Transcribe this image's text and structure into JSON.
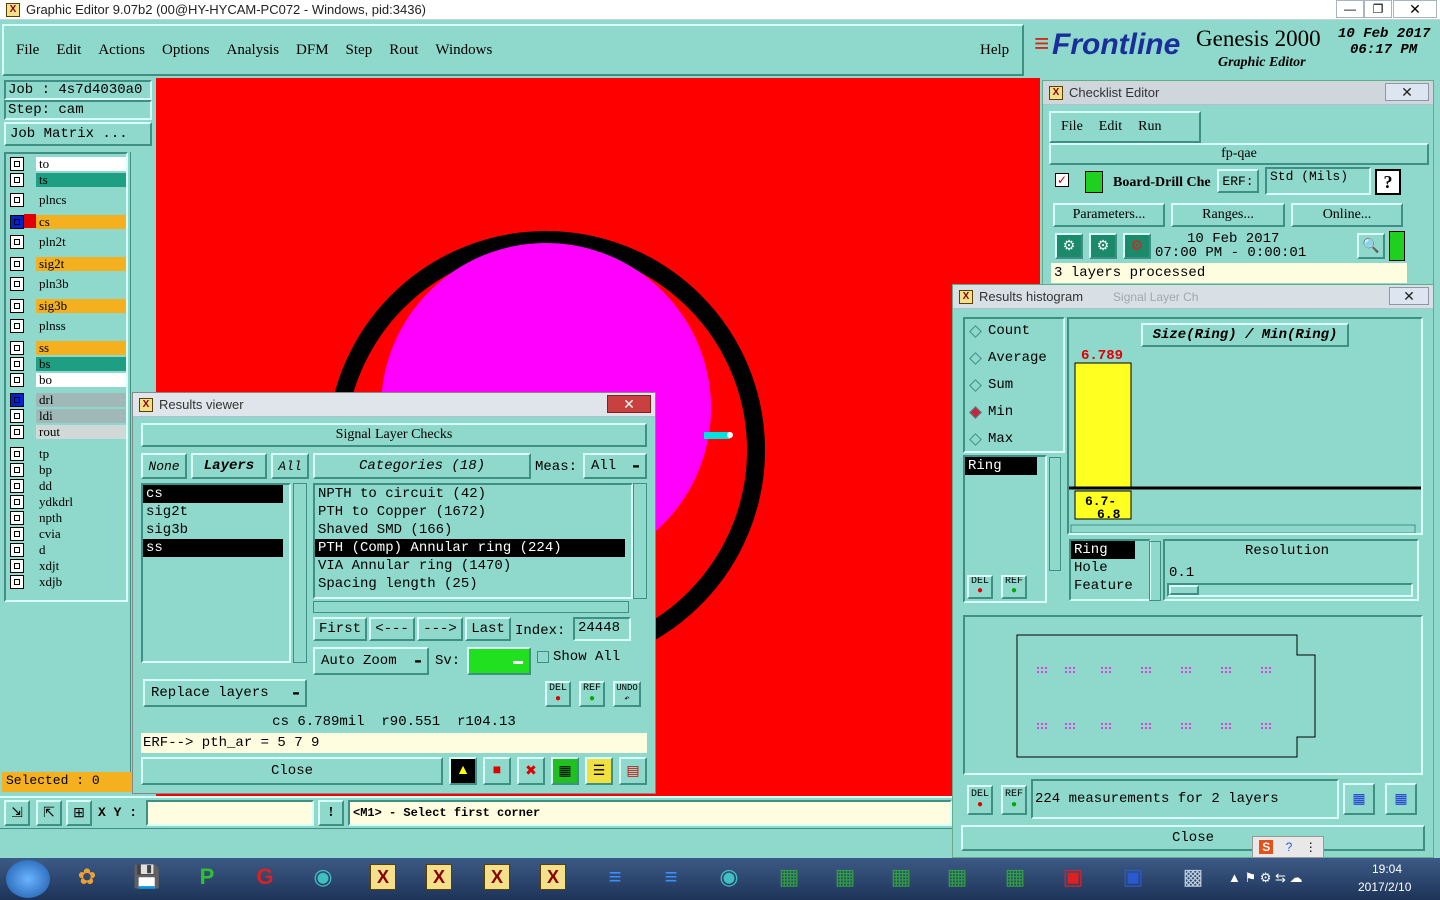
{
  "window": {
    "title": "Graphic Editor 9.07b2 (00@HY-HYCAM-PC072 - Windows, pid:3436)"
  },
  "menu": {
    "items": [
      "File",
      "Edit",
      "Actions",
      "Options",
      "Analysis",
      "DFM",
      "Step",
      "Rout",
      "Windows"
    ],
    "help": "Help"
  },
  "brand": {
    "logo": "Frontline",
    "product": "Genesis 2000",
    "subtitle": "Graphic Editor",
    "date": "10 Feb 2017",
    "time": "06:17 PM"
  },
  "job": {
    "job_label": "Job : 4s7d4030a0",
    "step_label": "Step: cam",
    "matrix_button": "Job Matrix ..."
  },
  "layers": [
    {
      "name": "to",
      "bg": "#ffffff"
    },
    {
      "name": "ts",
      "bg": "#1e9e82"
    },
    {
      "name": "plncs",
      "bg": "#8fd8cc"
    },
    {
      "name": "cs",
      "bg": "#f5b020"
    },
    {
      "name": "pln2t",
      "bg": "#8fd8cc"
    },
    {
      "name": "sig2t",
      "bg": "#f5b020"
    },
    {
      "name": "pln3b",
      "bg": "#8fd8cc"
    },
    {
      "name": "sig3b",
      "bg": "#f5b020"
    },
    {
      "name": "plnss",
      "bg": "#8fd8cc"
    },
    {
      "name": "ss",
      "bg": "#f5b020"
    },
    {
      "name": "bs",
      "bg": "#1e9e82"
    },
    {
      "name": "bo",
      "bg": "#ffffff"
    },
    {
      "name": "drl",
      "bg": "#a0b8b8"
    },
    {
      "name": "ldi",
      "bg": "#a0b8b8"
    },
    {
      "name": "rout",
      "bg": "#d0d8d8"
    },
    {
      "name": "tp",
      "bg": "#8fd8cc"
    },
    {
      "name": "bp",
      "bg": "#8fd8cc"
    },
    {
      "name": "dd",
      "bg": "#8fd8cc"
    },
    {
      "name": "ydkdrl",
      "bg": "#8fd8cc"
    },
    {
      "name": "npth",
      "bg": "#8fd8cc"
    },
    {
      "name": "cvia",
      "bg": "#8fd8cc"
    },
    {
      "name": "d",
      "bg": "#8fd8cc"
    },
    {
      "name": "xdjt",
      "bg": "#8fd8cc"
    },
    {
      "name": "xdjb",
      "bg": "#8fd8cc"
    }
  ],
  "status": {
    "selected": "Selected : 0",
    "xy_label": "X Y :",
    "prompt": "<M1> - Select first corner"
  },
  "results_viewer": {
    "title": "Results viewer",
    "heading": "Signal Layer Checks",
    "tabs": {
      "none": "None",
      "layers": "Layers",
      "all": "All"
    },
    "layer_list": [
      "cs",
      "sig2t",
      "sig3b",
      "ss"
    ],
    "categories_label": "Categories (18)",
    "meas_label": "Meas:",
    "meas_value": "All",
    "categories": [
      "NPTH to circuit (42)",
      "PTH to Copper (1672)",
      "Shaved SMD (166)",
      "PTH (Comp) Annular ring (224)",
      "VIA Annular ring (1470)",
      "Spacing length (25)"
    ],
    "nav": {
      "first": "First",
      "prev": "<---",
      "next": "--->",
      "last": "Last",
      "index_label": "Index:",
      "index_value": "24448"
    },
    "auto_zoom": "Auto Zoom",
    "sv_label": "Sv:",
    "show_all": "Show All",
    "replace_layers": "Replace layers",
    "small_buttons": {
      "del": "DEL",
      "ref": "REF",
      "undo": "UNDO"
    },
    "info": "cs 6.789mil  r90.551  r104.13",
    "erf": "ERF--> pth_ar = 5 7 9",
    "close": "Close"
  },
  "checklist": {
    "title": "Checklist Editor",
    "menu": [
      "File",
      "Edit",
      "Run"
    ],
    "name": "fp-qae",
    "check_name": "Board-Drill Che",
    "erf_label": "ERF:",
    "erf_value": "Std (Mils)",
    "help": "?",
    "buttons": [
      "Parameters...",
      "Ranges...",
      "Online..."
    ],
    "date": "10 Feb 2017",
    "time": "07:00 PM - 0:00:01",
    "status": "3 layers processed"
  },
  "histogram": {
    "title": "Results histogram",
    "ghost_title": "Signal Layer Ch",
    "modes": [
      "Count",
      "Average",
      "Sum",
      "Min",
      "Max"
    ],
    "selected_mode": "Min",
    "chart_title": "Size(Ring) / Min(Ring)",
    "list": [
      "Ring"
    ],
    "attrs": [
      "Ring",
      "Hole",
      "Feature"
    ],
    "resolution_label": "Resolution",
    "resolution_value": "0.1",
    "del": "DEL",
    "ref": "REF",
    "summary": "224 measurements for 2 layers",
    "close": "Close"
  },
  "chart_data": {
    "type": "bar",
    "title": "Size(Ring) / Min(Ring)",
    "categories": [
      "6.7-6.8"
    ],
    "values": [
      6.789
    ],
    "value_labels": [
      "6.789"
    ],
    "category_labels": [
      "6.7-",
      "6.8"
    ],
    "bar_color": "#ffff20"
  },
  "taskbar": {
    "time": "19:04",
    "date": "2017/2/10"
  }
}
